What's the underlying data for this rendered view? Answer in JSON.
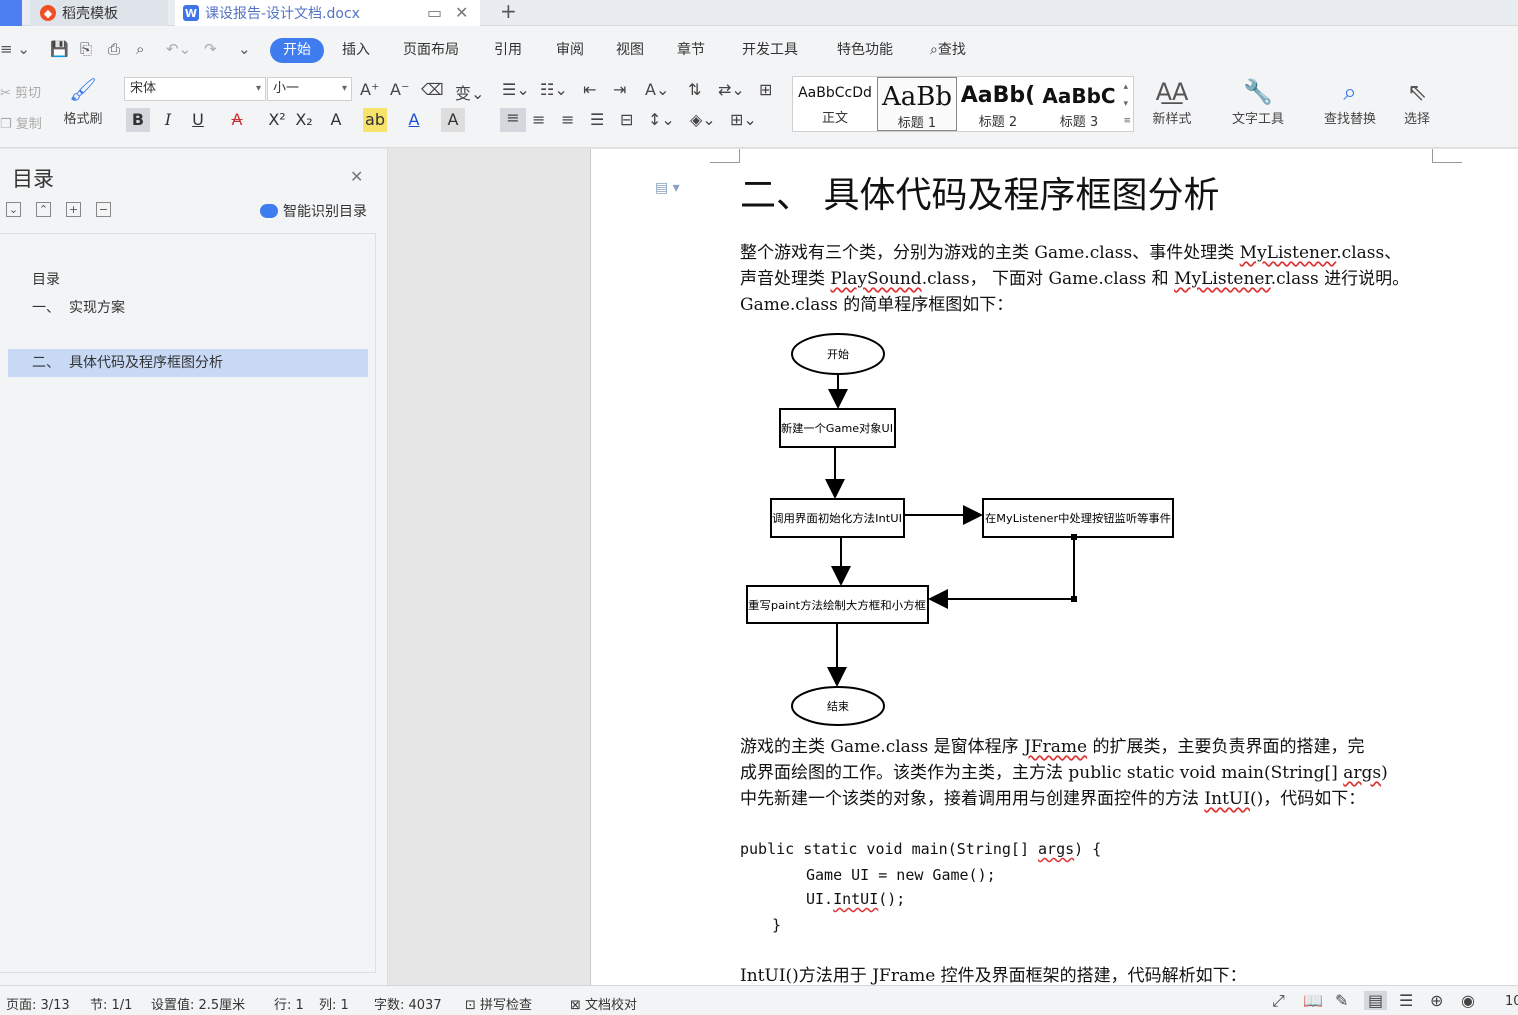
{
  "tabs": [
    {
      "label": "稻壳模板"
    },
    {
      "label": "课设报告-设计文档.docx"
    }
  ],
  "menu": [
    "开始",
    "插入",
    "页面布局",
    "引用",
    "审阅",
    "视图",
    "章节",
    "开发工具",
    "特色功能",
    "查找"
  ],
  "ribbon": {
    "cut": "剪切",
    "copy": "复制",
    "format_painter": "格式刷",
    "font_name": "宋体",
    "font_size": "小一",
    "styles": [
      {
        "sample": "AaBbCcDd",
        "name": "正文"
      },
      {
        "sample": "AaBb",
        "name": "标题 1"
      },
      {
        "sample": "AaBb(",
        "name": "标题 2"
      },
      {
        "sample": "AaBbC",
        "name": "标题 3"
      }
    ],
    "new_style": "新样式",
    "text_tools": "文字工具",
    "find_replace": "查找替换",
    "select": "选择"
  },
  "sidebar": {
    "title": "目录",
    "smart": "智能识别目录",
    "entries": [
      {
        "num": "",
        "text": "目录"
      },
      {
        "num": "一、",
        "text": "实现方案"
      },
      {
        "num": "二、",
        "text": "具体代码及程序框图分析"
      }
    ]
  },
  "doc": {
    "heading": "二、  具体代码及程序框图分析",
    "p1_a": "整个游戏有三个类，分别为游戏的主类 Game.class、事件处理类 ",
    "p1_b": "MyListener",
    "p1_c": ".class、",
    "p1_d": "声音处理类 ",
    "p1_e": "PlaySound",
    "p1_f": ".class， 下面对 Game.class 和 ",
    "p1_g": "MyListener",
    "p1_h": ".class 进行说明。",
    "p1_i": "Game.class 的简单程序框图如下：",
    "flow": {
      "start": "开始",
      "step1": "新建一个Game对象UI",
      "step2": "调用界面初始化方法IntUI",
      "step3": "在MyListener中处理按钮监听等事件",
      "step4": "重写paint方法绘制大方框和小方框",
      "end": "结束"
    },
    "p2_a": "游戏的主类 Game.class 是窗体程序 ",
    "p2_b": "JFrame",
    "p2_c": " 的扩展类，主要负责界面的搭建，完",
    "p2_d": "成界面绘图的工作。该类作为主类，主方法 public static void main(String[] ",
    "p2_e": "args",
    "p2_f": ")",
    "p2_g": "中先新建一个该类的对象，接着调用用与创建界面控件的方法 ",
    "p2_h": "IntUI",
    "p2_i": "()，代码如下：",
    "code1_a": "public static void main(String[] ",
    "code1_b": "args",
    "code1_c": ") {",
    "code2": "Game UI = new Game();",
    "code3_a": "UI.",
    "code3_b": "IntUI",
    "code3_c": "();",
    "code4": "}",
    "p3": "IntUI()方法用于 JFrame 控件及界面框架的搭建，代码解析如下："
  },
  "status": {
    "page": "页面: 3/13",
    "section": "节: 1/1",
    "setting": "设置值: 2.5厘米",
    "row": "行: 1",
    "col": "列: 1",
    "words": "字数: 4037",
    "spell": "拼写检查",
    "proof": "文档校对",
    "zoom": "10"
  }
}
